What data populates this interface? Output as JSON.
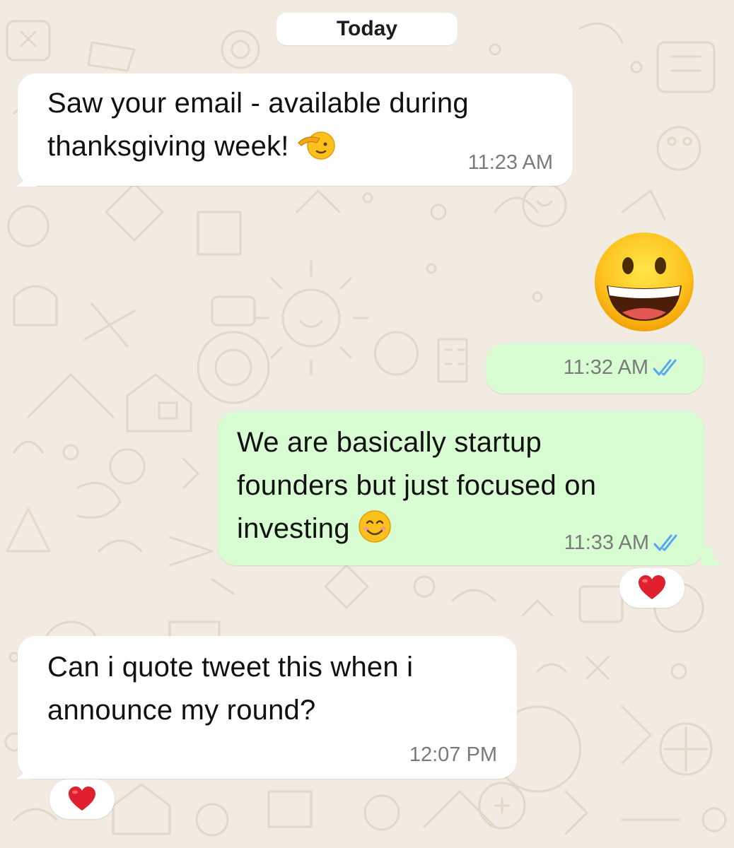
{
  "chat": {
    "date_separator": "Today",
    "messages": [
      {
        "direction": "incoming",
        "lines": [
          "Saw your email - available during",
          "thanksgiving week!"
        ],
        "emoji": "saluting-face",
        "time": "11:23 AM"
      },
      {
        "direction": "outgoing",
        "emoji": "grinning-face-with-big-eyes",
        "time": "11:32 AM",
        "status": "read"
      },
      {
        "direction": "outgoing",
        "lines": [
          "We are basically startup",
          "founders but just focused on",
          "investing"
        ],
        "emoji": "smiling-face-with-smiling-eyes",
        "time": "11:33 AM",
        "status": "read",
        "reaction": "red-heart"
      },
      {
        "direction": "incoming",
        "lines": [
          "Can i quote tweet this when i",
          "announce my round?"
        ],
        "time": "12:07 PM",
        "reaction": "red-heart"
      }
    ]
  },
  "colors": {
    "wallpaper": "#f2ebe2",
    "wallpaper_doodle": "#e3d7c7",
    "incoming_bubble": "#ffffff",
    "outgoing_bubble": "#d9fdd3",
    "read_ticks": "#53a7f5",
    "timestamp": "#7a7a7a",
    "reaction_heart": "#e0202e"
  }
}
